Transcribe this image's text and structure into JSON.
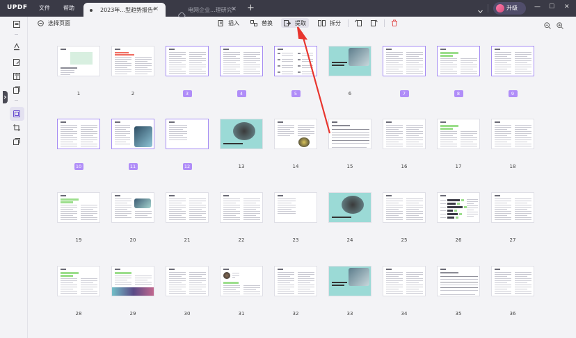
{
  "titlebar": {
    "logo": "UPDF",
    "menu": [
      "文件",
      "帮助"
    ],
    "tabs": [
      {
        "label": "2023年...型趋势报告*",
        "close": "×",
        "active": true
      },
      {
        "label": "电网企业...理研究*",
        "close": "×",
        "active": false
      }
    ],
    "new_tab": "+",
    "upgrade_label": "升级",
    "window_buttons": [
      "—",
      "☐",
      "✕"
    ]
  },
  "toolbar": {
    "select_pages": "选择页面",
    "insert": "插入",
    "replace": "替换",
    "extract": "提取",
    "split": "拆分"
  },
  "pages": [
    {
      "n": "1",
      "selected": false,
      "style": "cover"
    },
    {
      "n": "2",
      "selected": false,
      "style": "redtext"
    },
    {
      "n": "3",
      "selected": true,
      "style": "text"
    },
    {
      "n": "4",
      "selected": true,
      "style": "text"
    },
    {
      "n": "5",
      "selected": true,
      "style": "list"
    },
    {
      "n": "6",
      "selected": false,
      "style": "photo-teal"
    },
    {
      "n": "7",
      "selected": true,
      "style": "text"
    },
    {
      "n": "8",
      "selected": true,
      "style": "green"
    },
    {
      "n": "9",
      "selected": true,
      "style": "text"
    },
    {
      "n": "10",
      "selected": true,
      "style": "text"
    },
    {
      "n": "11",
      "selected": true,
      "style": "photo-right"
    },
    {
      "n": "12",
      "selected": true,
      "style": "short"
    },
    {
      "n": "13",
      "selected": false,
      "style": "teal-people"
    },
    {
      "n": "14",
      "selected": false,
      "style": "photo-small"
    },
    {
      "n": "15",
      "selected": false,
      "style": "table"
    },
    {
      "n": "16",
      "selected": false,
      "style": "text"
    },
    {
      "n": "17",
      "selected": false,
      "style": "green"
    },
    {
      "n": "18",
      "selected": false,
      "style": "text"
    },
    {
      "n": "19",
      "selected": false,
      "style": "green"
    },
    {
      "n": "20",
      "selected": false,
      "style": "photo-top"
    },
    {
      "n": "21",
      "selected": false,
      "style": "text"
    },
    {
      "n": "22",
      "selected": false,
      "style": "text"
    },
    {
      "n": "23",
      "selected": false,
      "style": "short"
    },
    {
      "n": "24",
      "selected": false,
      "style": "teal-people"
    },
    {
      "n": "25",
      "selected": false,
      "style": "text"
    },
    {
      "n": "26",
      "selected": false,
      "style": "bars"
    },
    {
      "n": "27",
      "selected": false,
      "style": "text"
    },
    {
      "n": "28",
      "selected": false,
      "style": "green"
    },
    {
      "n": "29",
      "selected": false,
      "style": "photo-bottom"
    },
    {
      "n": "30",
      "selected": false,
      "style": "text"
    },
    {
      "n": "31",
      "selected": false,
      "style": "profile"
    },
    {
      "n": "32",
      "selected": false,
      "style": "text"
    },
    {
      "n": "33",
      "selected": false,
      "style": "photo-teal"
    },
    {
      "n": "34",
      "selected": false,
      "style": "text"
    },
    {
      "n": "35",
      "selected": false,
      "style": "table"
    },
    {
      "n": "36",
      "selected": false,
      "style": "text"
    }
  ],
  "colors": {
    "accent": "#b08df8",
    "titlebar": "#3a3a46",
    "arrow": "#e8352e",
    "delete": "#e25555"
  }
}
